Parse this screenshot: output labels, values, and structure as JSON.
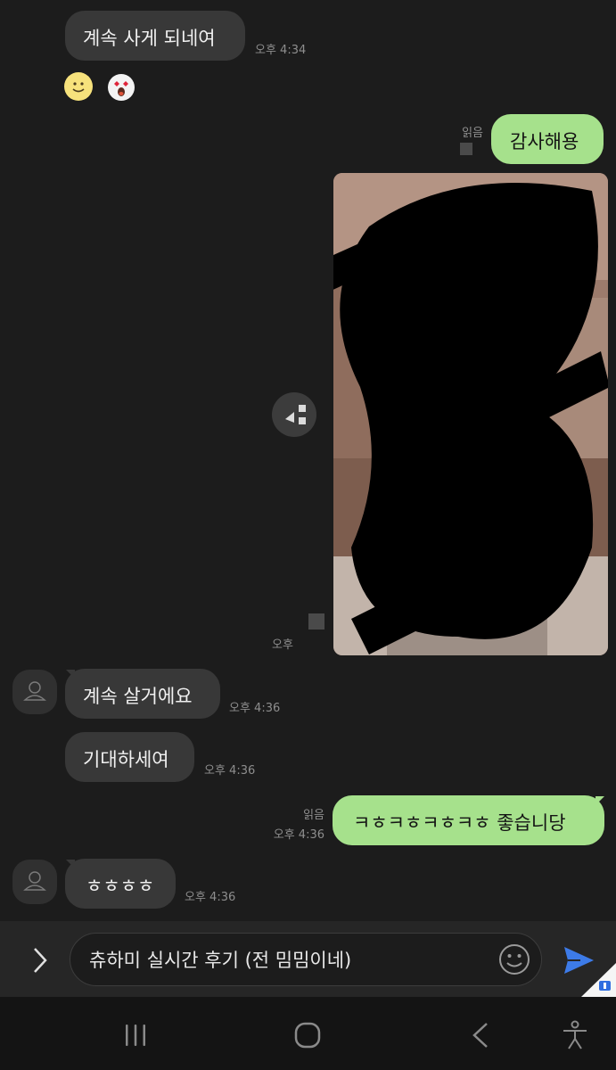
{
  "messages": [
    {
      "direction": "in",
      "text": "계속 사게 되네여",
      "time": "오후 4:34"
    },
    {
      "direction": "in",
      "type": "emoticons",
      "icons": [
        "smiley-emoticon-icon",
        "heart-eyes-emoticon-icon"
      ]
    },
    {
      "direction": "out",
      "text": "감사해용",
      "read_status": "읽음"
    },
    {
      "direction": "out",
      "type": "photo",
      "time": "오후"
    },
    {
      "direction": "in",
      "text": "계속 살거에요",
      "time": "오후 4:36"
    },
    {
      "direction": "in",
      "text": "기대하세여",
      "time": "오후 4:36"
    },
    {
      "direction": "out",
      "text": "ㅋㅎㅋㅎㅋㅎㅋㅎ 좋습니당",
      "read_status": "읽음",
      "time": "오후 4:36"
    },
    {
      "direction": "in",
      "text": "ㅎㅎㅎㅎ",
      "time": "오후 4:36"
    }
  ],
  "input": {
    "value": "츄하미 실시간 후기 (전 밈밈이네)"
  },
  "colors": {
    "background": "#1c1c1c",
    "incoming_bubble": "#383838",
    "outgoing_bubble": "#a6e18c",
    "send_button": "#3d7be8"
  }
}
